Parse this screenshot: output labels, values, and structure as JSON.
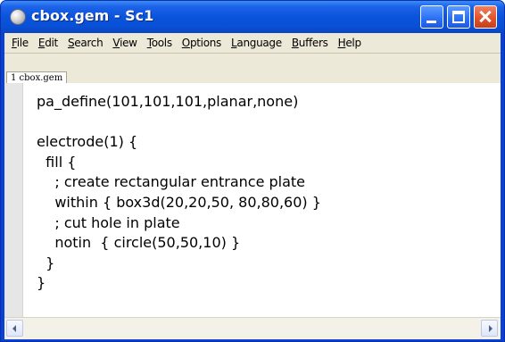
{
  "window": {
    "title": "cbox.gem - Sc1",
    "colors": {
      "titlebar": "#0a53dc",
      "close_button": "#e0502a",
      "chrome": "#ece9d8",
      "gutter": "#e6e6e6"
    }
  },
  "icons": {
    "app": "app-globe-icon",
    "minimize": "minimize-icon",
    "maximize": "maximize-icon",
    "close": "close-icon",
    "scroll_left": "arrow-left-icon",
    "scroll_right": "arrow-right-icon"
  },
  "menu": {
    "items": [
      {
        "accel": "F",
        "rest": "ile"
      },
      {
        "accel": "E",
        "rest": "dit"
      },
      {
        "accel": "S",
        "rest": "earch"
      },
      {
        "accel": "V",
        "rest": "iew"
      },
      {
        "accel": "T",
        "rest": "ools"
      },
      {
        "accel": "O",
        "rest": "ptions"
      },
      {
        "accel": "L",
        "rest": "anguage"
      },
      {
        "accel": "B",
        "rest": "uffers"
      },
      {
        "accel": "H",
        "rest": "elp"
      }
    ]
  },
  "tabs": [
    {
      "label": "1 cbox.gem"
    }
  ],
  "editor": {
    "lines": [
      "pa_define(101,101,101,planar,none)",
      "",
      "electrode(1) {",
      "  fill {",
      "    ; create rectangular entrance plate",
      "    within { box3d(20,20,50, 80,80,60) }",
      "    ; cut hole in plate",
      "    notin  { circle(50,50,10) }",
      "  }",
      "}"
    ]
  }
}
